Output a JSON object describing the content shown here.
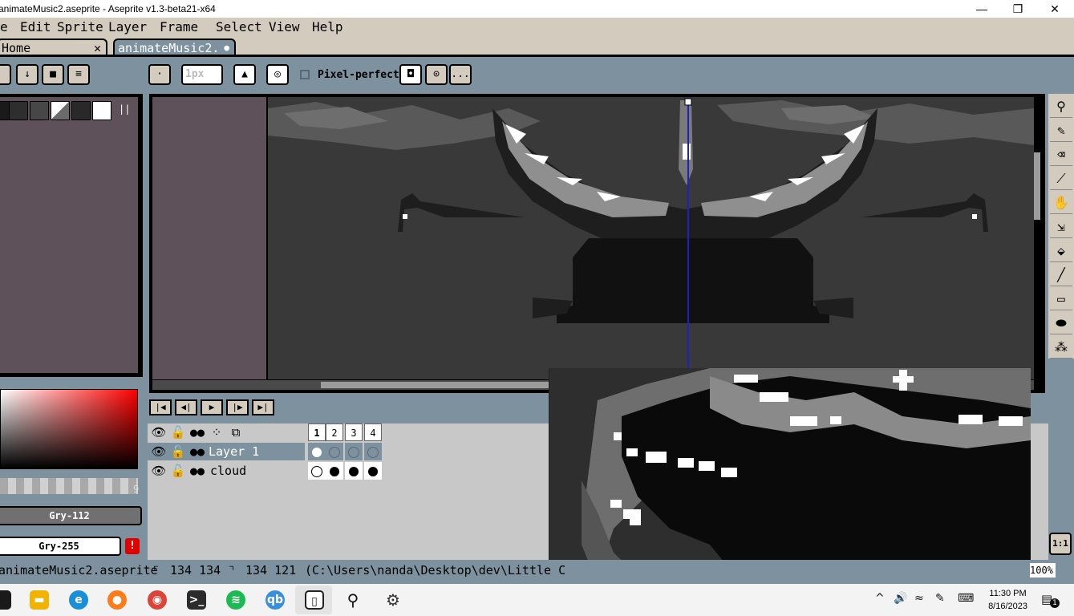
{
  "window": {
    "title": "animateMusic2.aseprite - Aseprite v1.3-beta21-x64",
    "minimize": "—",
    "maximize": "❐",
    "close": "✕"
  },
  "menu": {
    "items": [
      "e",
      "Edit",
      "Sprite",
      "Layer",
      "Frame",
      "Select",
      "View",
      "Help"
    ]
  },
  "tabs": [
    {
      "label": "Home",
      "close": "✕"
    },
    {
      "label": "animateMusic2.",
      "modified": "●"
    }
  ],
  "toolbar": {
    "brush_size": "1px",
    "pixel_perfect_label": "Pixel-perfect",
    "more": "..."
  },
  "palette": {
    "swatches": [
      "#1a1a1a",
      "#2e2e2e",
      "#474747",
      "#6b6b6b",
      "#8a8a8a",
      "#292929",
      "#ffffff"
    ]
  },
  "colors": {
    "foreground": "Gry-112",
    "background": "Gry-255",
    "picker_index_label": "9"
  },
  "timeline": {
    "frames": [
      "1",
      "2",
      "3",
      "4"
    ],
    "layers": [
      {
        "name": "Layer 1",
        "frames": [
          "white",
          "empty",
          "empty",
          "empty"
        ]
      },
      {
        "name": "cloud",
        "frames": [
          "white",
          "black",
          "black",
          "black"
        ]
      }
    ]
  },
  "statusbar": {
    "filename": "animateMusic2.aseprite",
    "size": "134 134",
    "cursor": "134 121",
    "path": "(C:\\Users\\nanda\\Desktop\\dev\\Little C",
    "zoom": "100%"
  },
  "zoom_button": "1:1",
  "taskbar": {
    "time": "11:30 PM",
    "date": "8/16/2023",
    "notification_count": "1"
  }
}
